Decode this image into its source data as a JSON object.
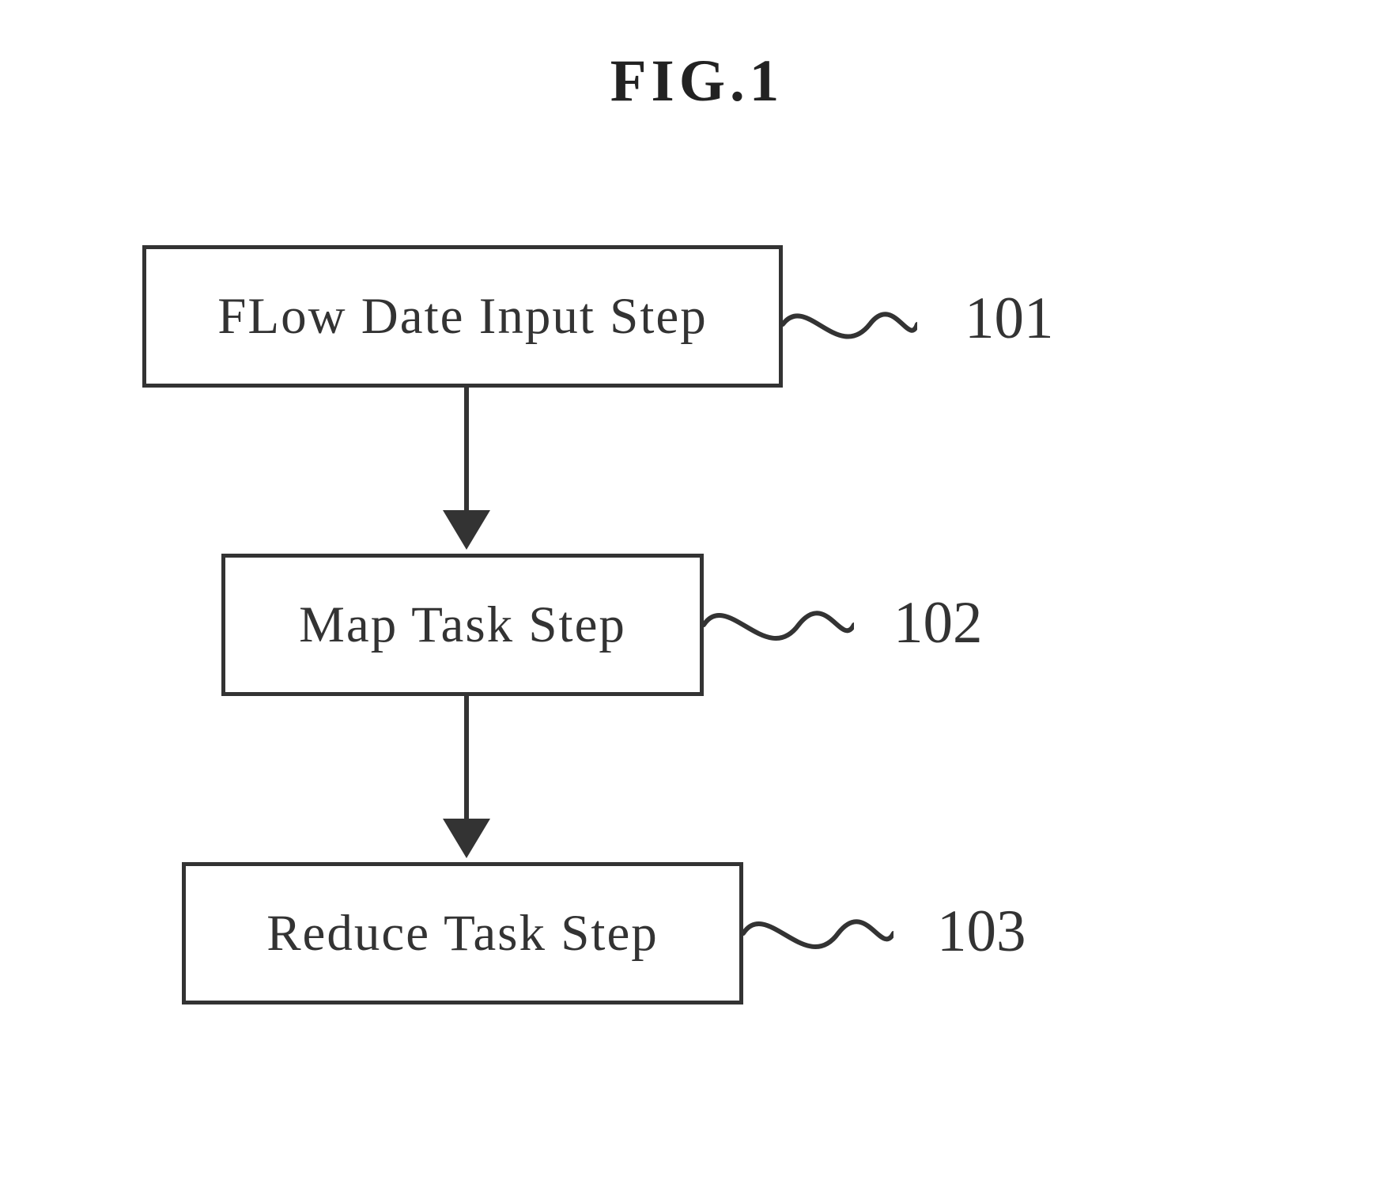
{
  "title": "FIG.1",
  "steps": [
    {
      "label": "FLow Date Input Step",
      "ref": "101"
    },
    {
      "label": "Map Task Step",
      "ref": "102"
    },
    {
      "label": "Reduce Task Step",
      "ref": "103"
    }
  ]
}
